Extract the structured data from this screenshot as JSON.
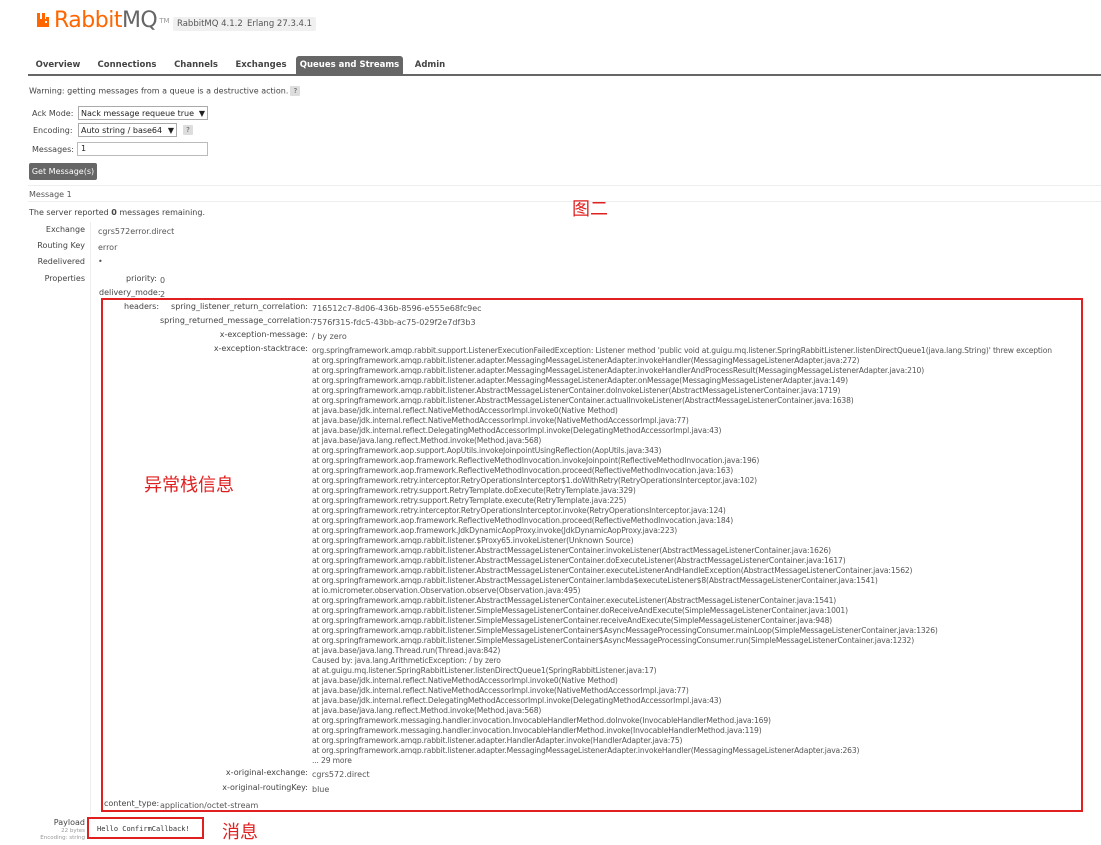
{
  "header": {
    "logo_rabbit": "Rabbit",
    "logo_mq": "MQ",
    "logo_tm": "TM",
    "rabbitmq_version": "RabbitMQ 4.1.2",
    "erlang_version": "Erlang 27.3.4.1"
  },
  "nav": {
    "tabs": [
      {
        "label": "Overview"
      },
      {
        "label": "Connections"
      },
      {
        "label": "Channels"
      },
      {
        "label": "Exchanges"
      },
      {
        "label": "Queues and Streams"
      },
      {
        "label": "Admin"
      }
    ],
    "active": "Queues and Streams"
  },
  "form": {
    "warning": "Warning: getting messages from a queue is a destructive action.",
    "help": "?",
    "ack_mode_label": "Ack Mode:",
    "ack_mode_value": "Nack message requeue true",
    "encoding_label": "Encoding:",
    "encoding_value": "Auto string / base64",
    "messages_label": "Messages:",
    "messages_value": "1",
    "get_button": "Get Message(s)"
  },
  "result": {
    "message_heading": "Message 1",
    "server_reported_prefix": "The server reported ",
    "remaining_count": "0",
    "server_reported_suffix": " messages remaining.",
    "exchange_label": "Exchange",
    "exchange_value": "cgrs572error.direct",
    "routing_key_label": "Routing Key",
    "routing_key_value": "error",
    "redelivered_label": "Redelivered",
    "redelivered_value": "•",
    "properties_label": "Properties",
    "priority_label": "priority:",
    "priority_value": "0",
    "delivery_mode_label": "delivery_mode:",
    "delivery_mode_value": "2",
    "headers_label": "headers:",
    "headers": {
      "return_corr_label": "spring_listener_return_correlation:",
      "return_corr_value": "716512c7-8d06-436b-8596-e555e68fc9ec",
      "returned_msg_corr_label": "spring_returned_message_correlation:",
      "returned_msg_corr_value": "7576f315-fdc5-43bb-ac75-029f2e7df3b3",
      "exc_msg_label": "x-exception-message:",
      "exc_msg_value": "/ by zero",
      "exc_stack_label": "x-exception-stacktrace:",
      "stacktrace": [
        "org.springframework.amqp.rabbit.support.ListenerExecutionFailedException: Listener method 'public void at.guigu.mq.listener.SpringRabbitListener.listenDirectQueue1(java.lang.String)' threw exception",
        "at org.springframework.amqp.rabbit.listener.adapter.MessagingMessageListenerAdapter.invokeHandler(MessagingMessageListenerAdapter.java:272)",
        "at org.springframework.amqp.rabbit.listener.adapter.MessagingMessageListenerAdapter.invokeHandlerAndProcessResult(MessagingMessageListenerAdapter.java:210)",
        "at org.springframework.amqp.rabbit.listener.adapter.MessagingMessageListenerAdapter.onMessage(MessagingMessageListenerAdapter.java:149)",
        "at org.springframework.amqp.rabbit.listener.AbstractMessageListenerContainer.doInvokeListener(AbstractMessageListenerContainer.java:1719)",
        "at org.springframework.amqp.rabbit.listener.AbstractMessageListenerContainer.actualInvokeListener(AbstractMessageListenerContainer.java:1638)",
        "at java.base/jdk.internal.reflect.NativeMethodAccessorImpl.invoke0(Native Method)",
        "at java.base/jdk.internal.reflect.NativeMethodAccessorImpl.invoke(NativeMethodAccessorImpl.java:77)",
        "at java.base/jdk.internal.reflect.DelegatingMethodAccessorImpl.invoke(DelegatingMethodAccessorImpl.java:43)",
        "at java.base/java.lang.reflect.Method.invoke(Method.java:568)",
        "at org.springframework.aop.support.AopUtils.invokeJoinpointUsingReflection(AopUtils.java:343)",
        "at org.springframework.aop.framework.ReflectiveMethodInvocation.invokeJoinpoint(ReflectiveMethodInvocation.java:196)",
        "at org.springframework.aop.framework.ReflectiveMethodInvocation.proceed(ReflectiveMethodInvocation.java:163)",
        "at org.springframework.retry.interceptor.RetryOperationsInterceptor$1.doWithRetry(RetryOperationsInterceptor.java:102)",
        "at org.springframework.retry.support.RetryTemplate.doExecute(RetryTemplate.java:329)",
        "at org.springframework.retry.support.RetryTemplate.execute(RetryTemplate.java:225)",
        "at org.springframework.retry.interceptor.RetryOperationsInterceptor.invoke(RetryOperationsInterceptor.java:124)",
        "at org.springframework.aop.framework.ReflectiveMethodInvocation.proceed(ReflectiveMethodInvocation.java:184)",
        "at org.springframework.aop.framework.JdkDynamicAopProxy.invoke(JdkDynamicAopProxy.java:223)",
        "at org.springframework.amqp.rabbit.listener.$Proxy65.invokeListener(Unknown Source)",
        "at org.springframework.amqp.rabbit.listener.AbstractMessageListenerContainer.invokeListener(AbstractMessageListenerContainer.java:1626)",
        "at org.springframework.amqp.rabbit.listener.AbstractMessageListenerContainer.doExecuteListener(AbstractMessageListenerContainer.java:1617)",
        "at org.springframework.amqp.rabbit.listener.AbstractMessageListenerContainer.executeListenerAndHandleException(AbstractMessageListenerContainer.java:1562)",
        "at org.springframework.amqp.rabbit.listener.AbstractMessageListenerContainer.lambda$executeListener$8(AbstractMessageListenerContainer.java:1541)",
        "at io.micrometer.observation.Observation.observe(Observation.java:495)",
        "at org.springframework.amqp.rabbit.listener.AbstractMessageListenerContainer.executeListener(AbstractMessageListenerContainer.java:1541)",
        "at org.springframework.amqp.rabbit.listener.SimpleMessageListenerContainer.doReceiveAndExecute(SimpleMessageListenerContainer.java:1001)",
        "at org.springframework.amqp.rabbit.listener.SimpleMessageListenerContainer.receiveAndExecute(SimpleMessageListenerContainer.java:948)",
        "at org.springframework.amqp.rabbit.listener.SimpleMessageListenerContainer$AsyncMessageProcessingConsumer.mainLoop(SimpleMessageListenerContainer.java:1326)",
        "at org.springframework.amqp.rabbit.listener.SimpleMessageListenerContainer$AsyncMessageProcessingConsumer.run(SimpleMessageListenerContainer.java:1232)",
        "at java.base/java.lang.Thread.run(Thread.java:842)",
        "Caused by: java.lang.ArithmeticException: / by zero",
        "at at.guigu.mq.listener.SpringRabbitListener.listenDirectQueue1(SpringRabbitListener.java:17)",
        "at java.base/jdk.internal.reflect.NativeMethodAccessorImpl.invoke0(Native Method)",
        "at java.base/jdk.internal.reflect.NativeMethodAccessorImpl.invoke(NativeMethodAccessorImpl.java:77)",
        "at java.base/jdk.internal.reflect.DelegatingMethodAccessorImpl.invoke(DelegatingMethodAccessorImpl.java:43)",
        "at java.base/java.lang.reflect.Method.invoke(Method.java:568)",
        "at org.springframework.messaging.handler.invocation.InvocableHandlerMethod.doInvoke(InvocableHandlerMethod.java:169)",
        "at org.springframework.messaging.handler.invocation.InvocableHandlerMethod.invoke(InvocableHandlerMethod.java:119)",
        "at org.springframework.amqp.rabbit.listener.adapter.HandlerAdapter.invoke(HandlerAdapter.java:75)",
        "at org.springframework.amqp.rabbit.listener.adapter.MessagingMessageListenerAdapter.invokeHandler(MessagingMessageListenerAdapter.java:263)",
        "... 29 more"
      ],
      "orig_exchange_label": "x-original-exchange:",
      "orig_exchange_value": "cgrs572.direct",
      "orig_rk_label": "x-original-routingKey:",
      "orig_rk_value": "blue"
    },
    "content_type_label": "content_type:",
    "content_type_value": "application/octet-stream",
    "payload_label": "Payload",
    "payload_bytes": "22 bytes",
    "payload_encoding": "Encoding: string",
    "payload_value": "Hello ConfirmCallback!"
  },
  "annotations": {
    "figure_label": "图二",
    "stack_label": "异常栈信息",
    "message_label": "消息",
    "color": "#e02020"
  },
  "colors": {
    "brand_orange": "#ff6600",
    "tab_active_bg": "#666666"
  }
}
